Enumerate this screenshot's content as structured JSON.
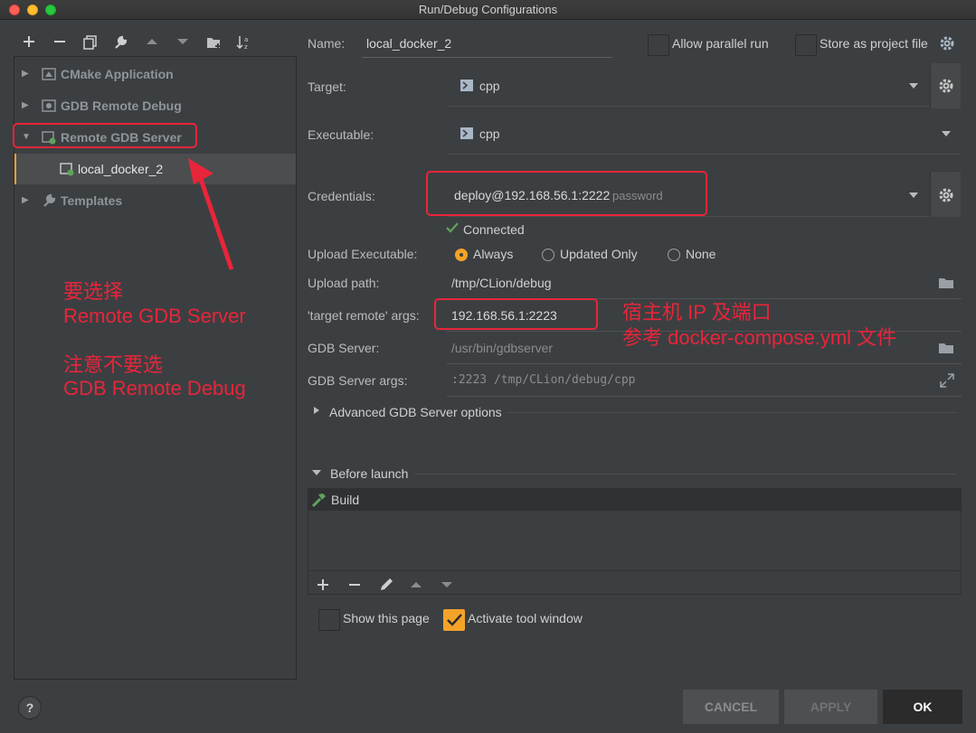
{
  "window": {
    "title": "Run/Debug Configurations"
  },
  "toolbar": {
    "icons": [
      "plus-icon",
      "minus-icon",
      "copy-icon",
      "wrench-icon",
      "arrow-up-icon",
      "arrow-down-icon",
      "folder-add-icon",
      "sort-az-icon"
    ]
  },
  "tree": {
    "items": [
      {
        "label": "CMake Application",
        "expanded": false
      },
      {
        "label": "GDB Remote Debug",
        "expanded": false
      },
      {
        "label": "Remote GDB Server",
        "expanded": true
      },
      {
        "label": "local_docker_2",
        "selected": true
      },
      {
        "label": "Templates",
        "expanded": false
      }
    ]
  },
  "form": {
    "name_label": "Name:",
    "name_value": "local_docker_2",
    "allow_parallel_label": "Allow parallel run",
    "store_project_label": "Store as project file",
    "target_label": "Target:",
    "target_value": "cpp",
    "executable_label": "Executable:",
    "executable_value": "cpp",
    "credentials_label": "Credentials:",
    "credentials_value": "deploy@192.168.56.1:2222",
    "credentials_hint": "password",
    "connected_label": "Connected",
    "upload_exec_label": "Upload Executable:",
    "upload_options": [
      "Always",
      "Updated Only",
      "None"
    ],
    "upload_selected": "Always",
    "upload_path_label": "Upload path:",
    "upload_path_value": "/tmp/CLion/debug",
    "target_remote_label": "'target remote' args:",
    "target_remote_value": "192.168.56.1:2223",
    "gdb_server_label": "GDB Server:",
    "gdb_server_value": "/usr/bin/gdbserver",
    "gdb_server_args_label": "GDB Server args:",
    "gdb_server_args_value": ":2223 /tmp/CLion/debug/cpp",
    "advanced_label": "Advanced GDB Server options"
  },
  "before_launch": {
    "title": "Before launch",
    "items": [
      "Build"
    ]
  },
  "options": {
    "show_page_label": "Show this page",
    "show_page_checked": false,
    "activate_tool_label": "Activate tool window",
    "activate_tool_checked": true
  },
  "buttons": {
    "help": "?",
    "cancel": "CANCEL",
    "apply": "APPLY",
    "ok": "OK"
  },
  "annotations": {
    "left_line1": "要选择",
    "left_line2": "Remote GDB Server",
    "left_line3": "注意不要选",
    "left_line4": "GDB Remote Debug",
    "right_line1": "宿主机 IP 及端口",
    "right_line2": "参考 docker-compose.yml 文件"
  },
  "colors": {
    "accent": "#f4a329",
    "annotation": "#e8253b",
    "connected": "#5fa35c"
  }
}
